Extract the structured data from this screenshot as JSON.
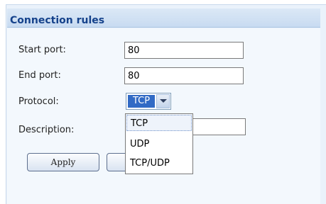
{
  "panel": {
    "title": "Connection rules"
  },
  "form": {
    "start_port": {
      "label": "Start port:",
      "value": "80"
    },
    "end_port": {
      "label": "End port:",
      "value": "80"
    },
    "protocol": {
      "label": "Protocol:",
      "selected": "TCP",
      "options": [
        "TCP",
        "UDP",
        "TCP/UDP"
      ]
    },
    "description": {
      "label": "Description:",
      "value": ""
    }
  },
  "buttons": {
    "apply": "Apply",
    "second": ""
  },
  "icons": {
    "dropdown_arrow": "chevron-down-icon"
  }
}
